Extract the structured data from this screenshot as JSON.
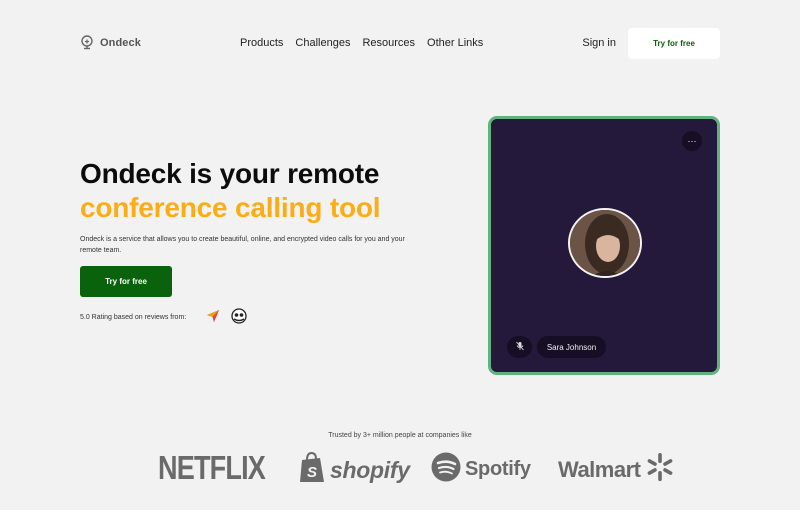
{
  "header": {
    "logo_text": "Ondeck",
    "nav": [
      "Products",
      "Challenges",
      "Resources",
      "Other Links"
    ],
    "signin_label": "Sign in",
    "cta_label": "Try for free"
  },
  "hero": {
    "title_line1": "Ondeck is your remote",
    "title_line2": "conference calling tool",
    "description": "Ondeck is a service that allows you to create beautiful, online, and encrypted video calls for you and your remote team.",
    "cta_label": "Try for free",
    "rating_text": "5.0 Rating based on reviews from:"
  },
  "video": {
    "more_label": "···",
    "participant_name": "Sara Johnson"
  },
  "trusted": {
    "text": "Trusted by 3+ million people at companies like",
    "brands": [
      "NETFLIX",
      "shopify",
      "Spotify",
      "Walmart"
    ]
  },
  "colors": {
    "accent": "#fbad17",
    "primary_green": "#0b620c",
    "video_bg": "#24193a",
    "video_border": "#5fb37c"
  }
}
